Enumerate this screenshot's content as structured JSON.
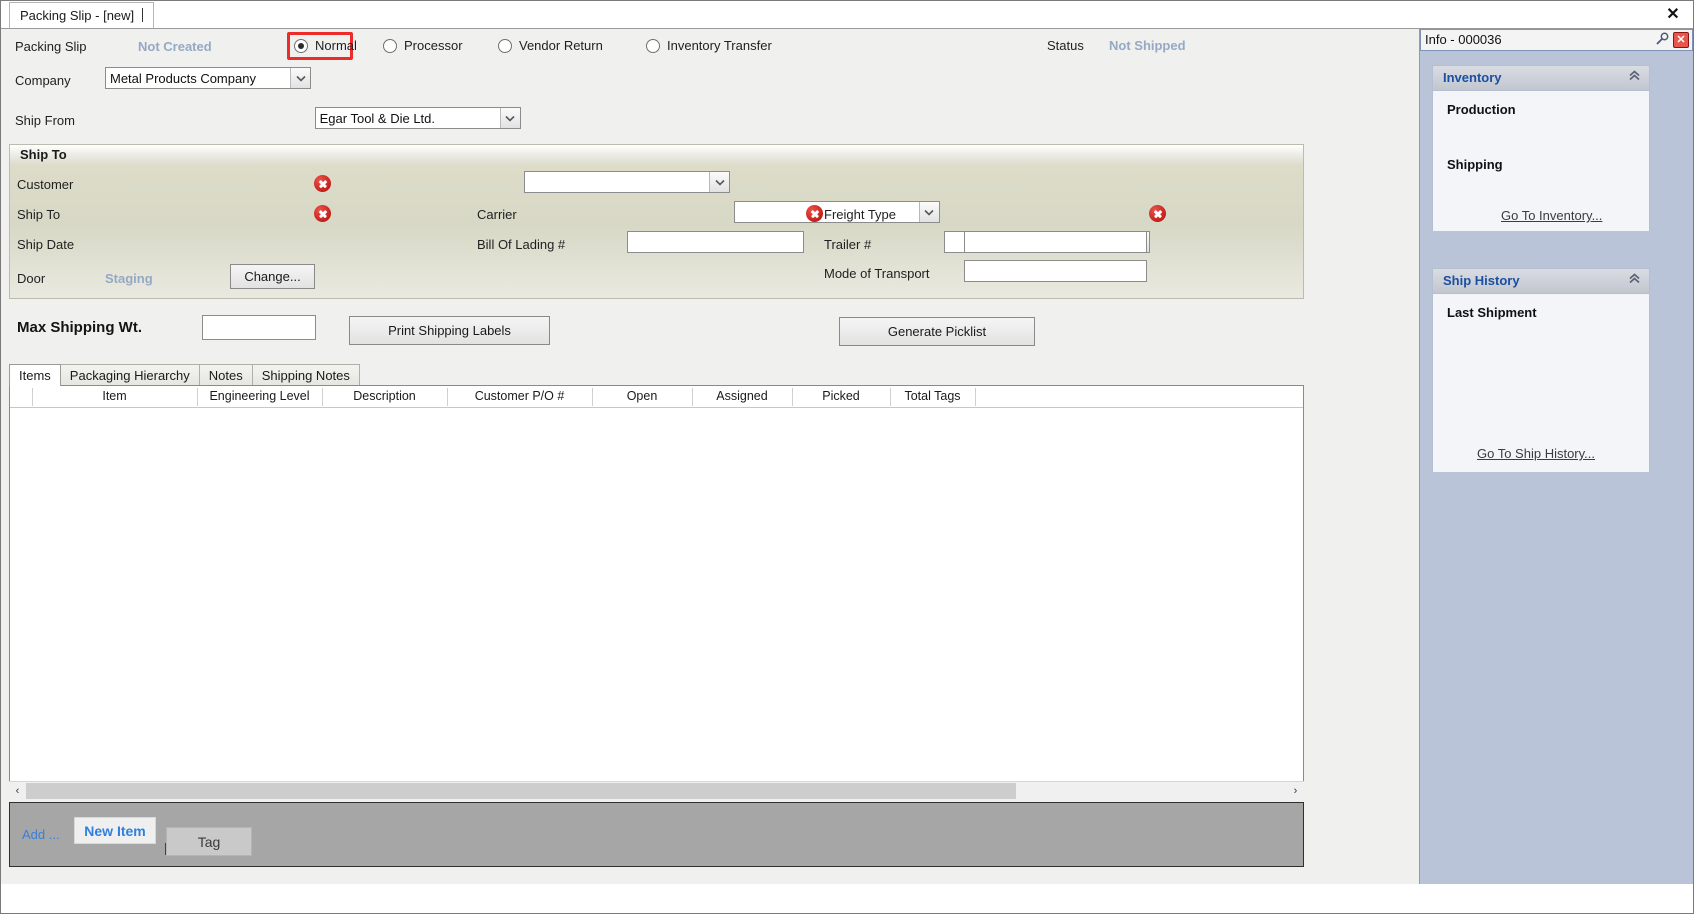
{
  "window": {
    "document_tab": "Packing Slip - [new]",
    "close_label": "✕"
  },
  "header": {
    "packing_slip_label": "Packing Slip",
    "packing_slip_value": "Not Created",
    "status_label": "Status",
    "status_value": "Not Shipped",
    "types": [
      {
        "label": "Normal",
        "selected": true,
        "highlighted": true
      },
      {
        "label": "Processor",
        "selected": false,
        "highlighted": false
      },
      {
        "label": "Vendor Return",
        "selected": false,
        "highlighted": false
      },
      {
        "label": "Inventory Transfer",
        "selected": false,
        "highlighted": false
      }
    ],
    "highlight_color": "#ee2b2b"
  },
  "company": {
    "label": "Company",
    "value": "Metal Products Company"
  },
  "ship_from": {
    "label": "Ship From",
    "value": "Egar Tool & Die Ltd."
  },
  "ship_to": {
    "group_title": "Ship To",
    "customer_label": "Customer",
    "customer_value": "",
    "ship_to_label": "Ship To",
    "ship_to_value": "",
    "ship_date_label": "Ship Date",
    "ship_date_value": "",
    "door_label": "Door",
    "door_value": "Staging",
    "change_button": "Change...",
    "carrier_label": "Carrier",
    "carrier_value": "",
    "bol_label": "Bill Of Lading #",
    "bol_value": "",
    "freight_type_label": "Freight Type",
    "freight_type_value": "",
    "trailer_label": "Trailer #",
    "trailer_value": "",
    "mode_label": "Mode of Transport",
    "mode_value": ""
  },
  "shipping": {
    "max_wt_label": "Max Shipping Wt.",
    "max_wt_value": "",
    "print_labels_button": "Print Shipping Labels",
    "generate_picklist_button": "Generate Picklist"
  },
  "tabs": [
    {
      "label": "Items",
      "active": true
    },
    {
      "label": "Packaging Hierarchy",
      "active": false
    },
    {
      "label": "Notes",
      "active": false
    },
    {
      "label": "Shipping Notes",
      "active": false
    }
  ],
  "grid": {
    "columns": [
      "Item",
      "Engineering Level",
      "Description",
      "Customer P/O #",
      "Open",
      "Assigned",
      "Picked",
      "Total Tags"
    ],
    "rows": []
  },
  "bottom_toolbar": {
    "add_label": "Add ...",
    "new_item_button": "New Item",
    "tag_button": "Tag"
  },
  "info_pane": {
    "title": "Info - 000036",
    "pin_icon": "pin-icon",
    "close_icon": "close-icon",
    "cards": [
      {
        "title": "Inventory",
        "collapse_icon": "chevron-up-icon",
        "rows": [
          "Production",
          "Shipping"
        ],
        "link": "Go To Inventory..."
      },
      {
        "title": "Ship History",
        "collapse_icon": "chevron-up-icon",
        "rows": [
          "Last Shipment"
        ],
        "link": "Go To Ship History..."
      }
    ]
  },
  "scrollbar": {
    "left_arrow": "‹",
    "right_arrow": "›"
  }
}
